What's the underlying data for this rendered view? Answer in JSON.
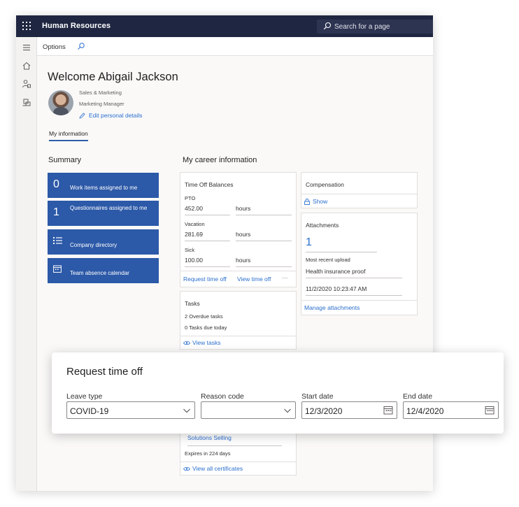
{
  "app": {
    "title": "Human Resources",
    "search_placeholder": "Search for a page"
  },
  "actionbar": {
    "options_label": "Options"
  },
  "rail": {
    "icons": [
      "hamburger-icon",
      "home-icon",
      "person-icon",
      "org-icon"
    ]
  },
  "profile": {
    "welcome": "Welcome Abigail Jackson",
    "department": "Sales & Marketing",
    "role": "Marketing Manager",
    "edit_label": "Edit personal details",
    "tab": "My information"
  },
  "summary": {
    "heading": "Summary",
    "tiles": [
      {
        "count": "0",
        "label": "Work items assigned to me"
      },
      {
        "count": "1",
        "label": "Questionnaires assigned to me"
      },
      {
        "icon": "list-icon",
        "label": "Company directory"
      },
      {
        "icon": "calendar-icon",
        "label": "Team absence calendar"
      }
    ]
  },
  "career": {
    "heading": "My career information",
    "timeoff": {
      "title": "Time Off Balances",
      "rows": [
        {
          "label": "PTO",
          "value": "452.00",
          "unit": "hours"
        },
        {
          "label": "Vacation",
          "value": "281.69",
          "unit": "hours"
        },
        {
          "label": "Sick",
          "value": "100.00",
          "unit": "hours"
        }
      ],
      "request_link": "Request time off",
      "view_link": "View time off",
      "more": "···"
    },
    "compensation": {
      "title": "Compensation",
      "show_link": "Show"
    },
    "attachments": {
      "title": "Attachments",
      "count": "1",
      "recent_label": "Most recent upload",
      "recent_name": "Health insurance proof",
      "recent_date": "11/2/2020 10:23:47 AM",
      "manage_link": "Manage attachments"
    },
    "tasks": {
      "title": "Tasks",
      "overdue": "2 Overdue tasks",
      "due_today": "0 Tasks due today",
      "view_link": "View tasks"
    },
    "certificates": {
      "name": "Solutions Selling",
      "expires": "Expires in 224 days",
      "view_link": "View all certificates"
    }
  },
  "request_panel": {
    "title": "Request time off",
    "leave_type": {
      "label": "Leave type",
      "value": "COVID-19"
    },
    "reason_code": {
      "label": "Reason code",
      "value": ""
    },
    "start_date": {
      "label": "Start date",
      "value": "12/3/2020"
    },
    "end_date": {
      "label": "End date",
      "value": "12/4/2020"
    }
  },
  "colors": {
    "topbar": "#1f2641",
    "tile": "#2c59a8",
    "link": "#2b6fce"
  }
}
